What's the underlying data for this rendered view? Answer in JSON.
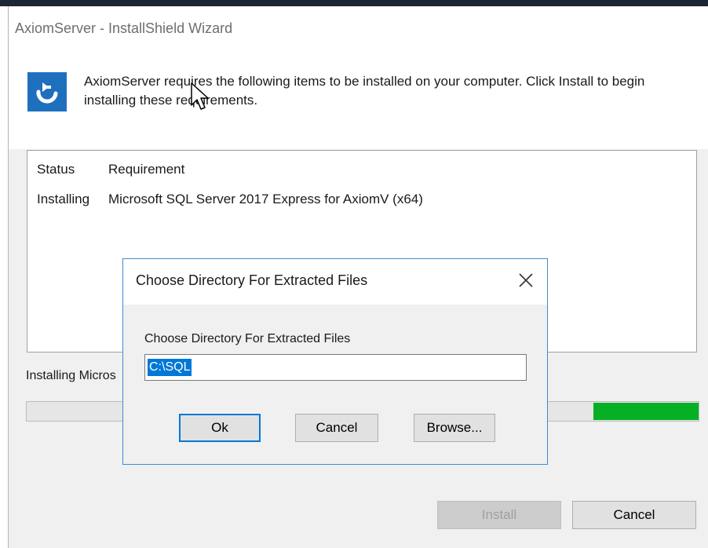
{
  "window": {
    "title": "AxiomServer - InstallShield Wizard",
    "header_text": "AxiomServer requires the following items to be installed on your computer. Click Install to begin installing these requirements.",
    "icon": "installshield-app-icon"
  },
  "requirements": {
    "columns": [
      "Status",
      "Requirement"
    ],
    "rows": [
      {
        "status": "Installing",
        "requirement": "Microsoft SQL Server 2017 Express for AxiomV (x64)"
      }
    ]
  },
  "progress": {
    "label": "Installing Micros",
    "fill_start_fraction": 0.843,
    "fill_color": "#06b025"
  },
  "buttons": {
    "install": "Install",
    "cancel": "Cancel"
  },
  "dialog": {
    "title": "Choose Directory For Extracted Files",
    "label": "Choose Directory For Extracted Files",
    "input_value": "C:\\SQL",
    "ok": "Ok",
    "cancel": "Cancel",
    "browse": "Browse...",
    "close_icon": "close-icon"
  },
  "colors": {
    "accent": "#0078d7",
    "dialog_border": "#3c8cd0",
    "app_icon_bg": "#1f6fbf"
  }
}
